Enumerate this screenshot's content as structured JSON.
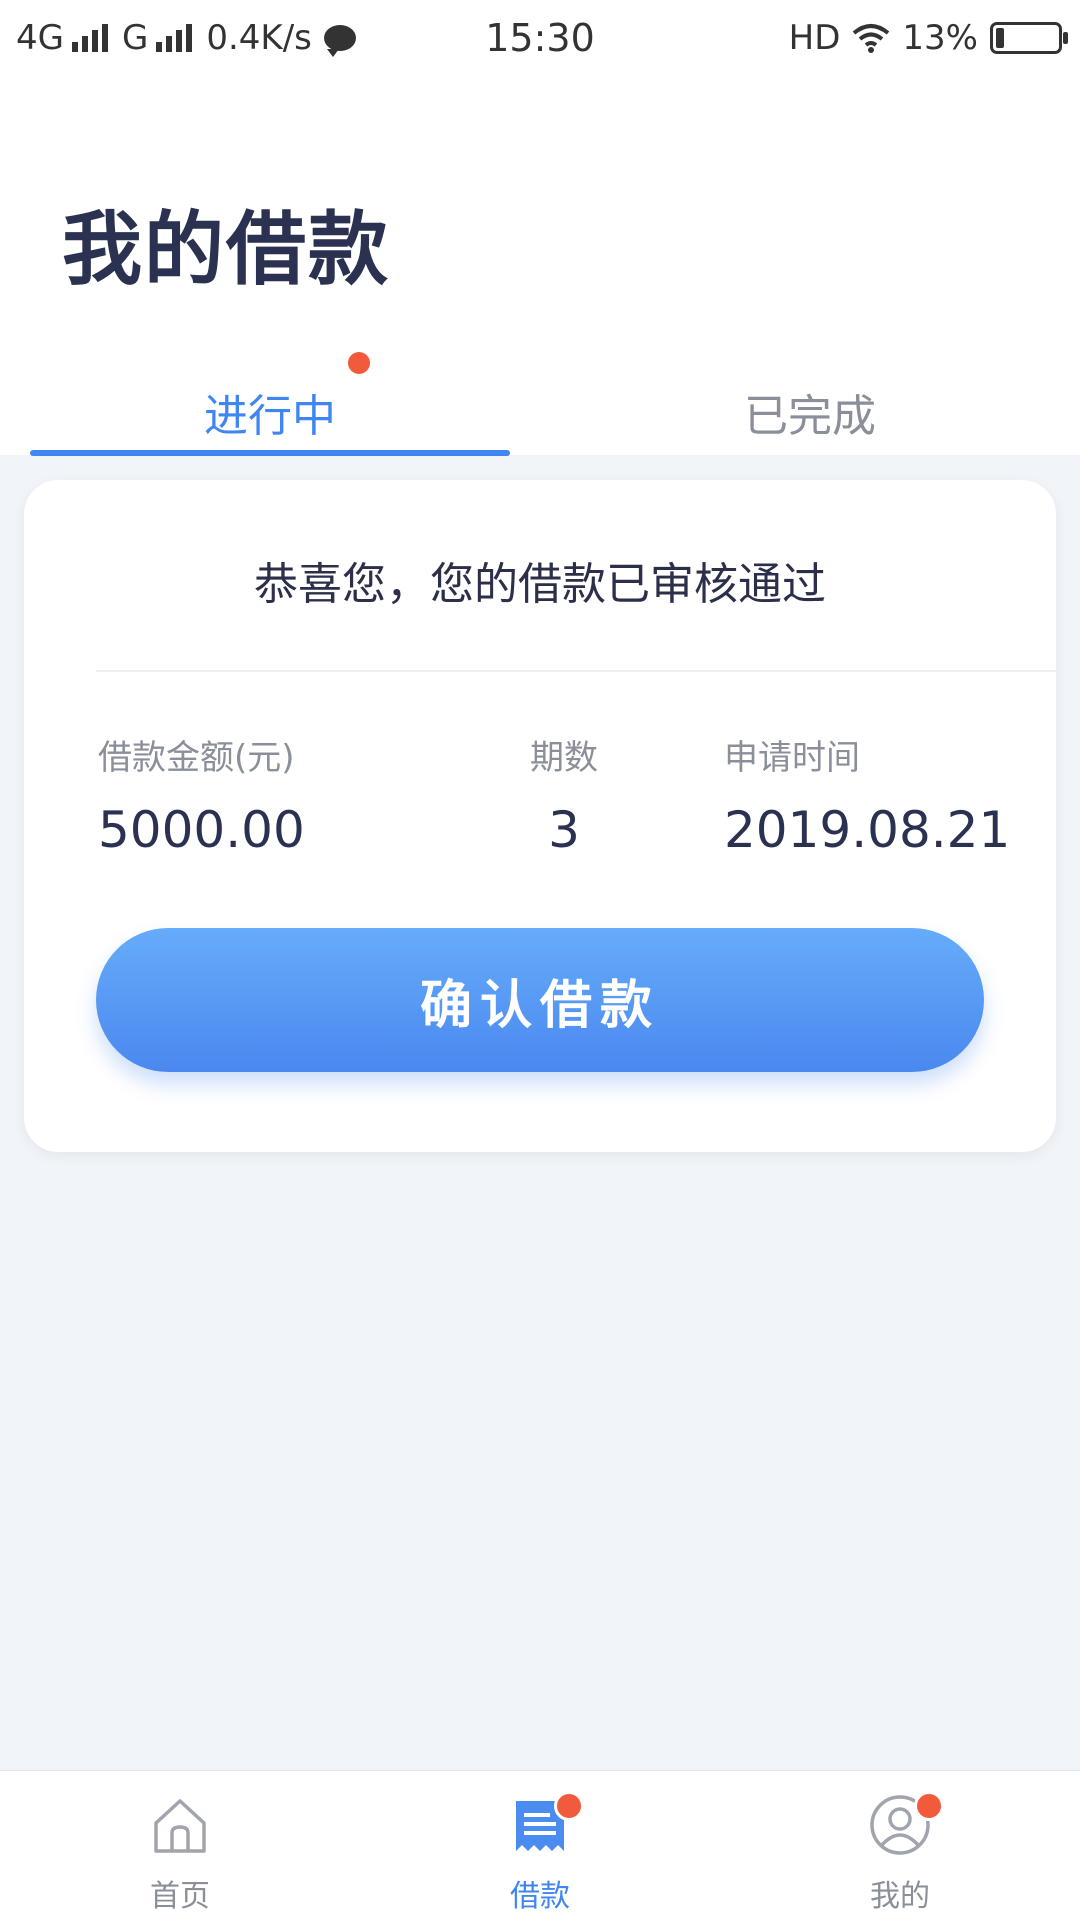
{
  "status_bar": {
    "network1": "4G",
    "network2": "G",
    "speed": "0.4K/s",
    "time": "15:30",
    "hd": "HD",
    "battery": "13%",
    "battery_level": 0.13
  },
  "header": {
    "title": "我的借款",
    "tabs": [
      {
        "label": "进行中",
        "active": true,
        "badge": true
      },
      {
        "label": "已完成",
        "active": false,
        "badge": false
      }
    ]
  },
  "card": {
    "message": "恭喜您，您的借款已审核通过",
    "amount_label": "借款金额(元)",
    "amount_value": "5000.00",
    "periods_label": "期数",
    "periods_value": "3",
    "date_label": "申请时间",
    "date_value": "2019.08.21",
    "confirm_label": "确认借款"
  },
  "bottom_nav": {
    "items": [
      {
        "label": "首页",
        "icon": "home-icon",
        "active": false,
        "badge": false
      },
      {
        "label": "借款",
        "icon": "loan-document-icon",
        "active": true,
        "badge": true
      },
      {
        "label": "我的",
        "icon": "user-profile-icon",
        "active": false,
        "badge": true
      }
    ]
  },
  "colors": {
    "accent": "#3f86f2",
    "badge": "#f25a3c",
    "background": "#f1f4f8"
  }
}
